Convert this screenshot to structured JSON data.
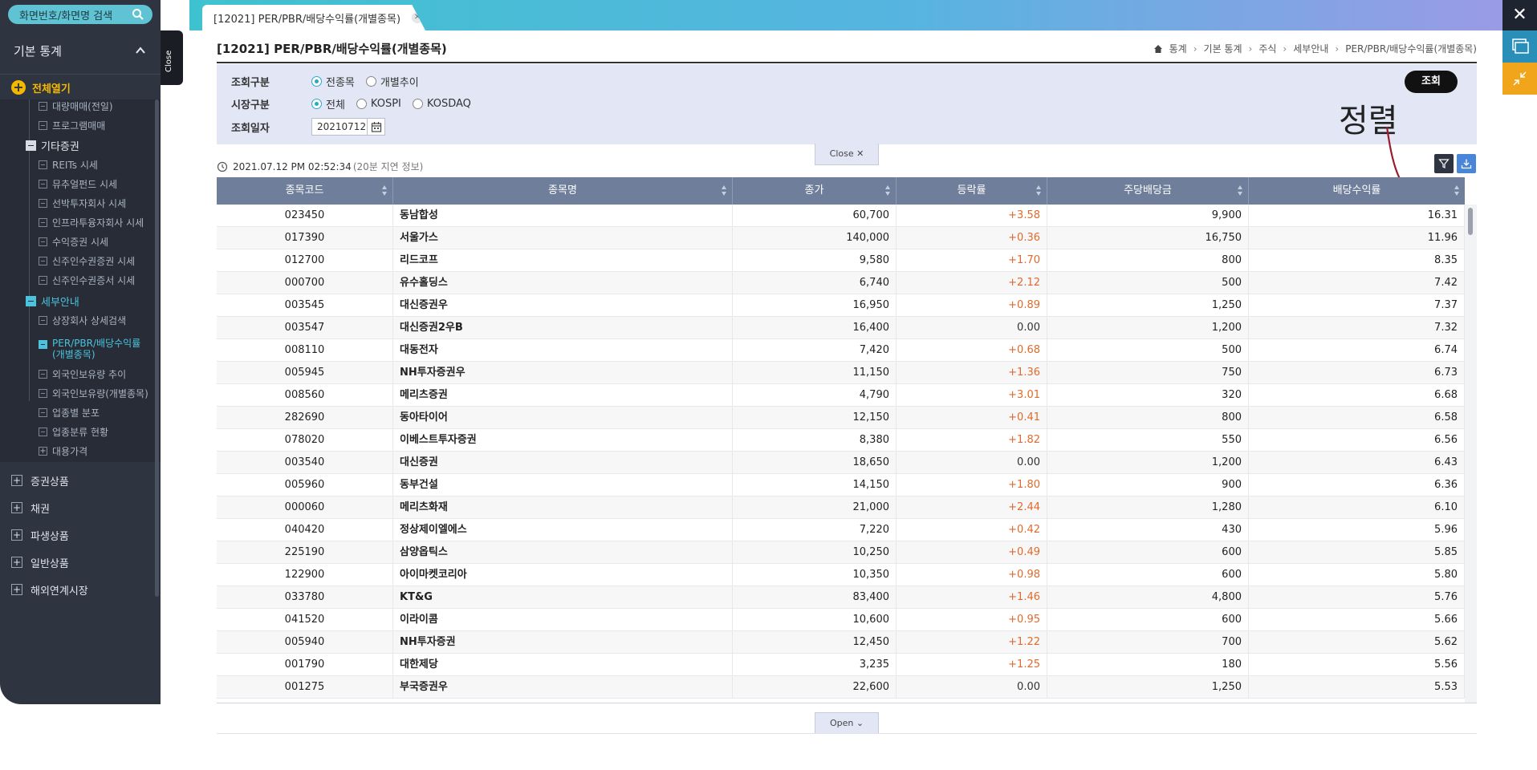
{
  "sidebar": {
    "search_placeholder": "화면번호/화면명 검색",
    "title": "기본 통계",
    "open_all": "전체열기",
    "tree": [
      {
        "label": "대량매매(전일)",
        "kind": "leaf"
      },
      {
        "label": "프로그램매매",
        "kind": "leaf"
      },
      {
        "label": "기타증권",
        "kind": "folder"
      },
      {
        "label": "REITs 시세",
        "kind": "leaf"
      },
      {
        "label": "뮤추얼펀드 시세",
        "kind": "leaf"
      },
      {
        "label": "선박투자회사 시세",
        "kind": "leaf"
      },
      {
        "label": "인프라투융자회사 시세",
        "kind": "leaf"
      },
      {
        "label": "수익증권 시세",
        "kind": "leaf"
      },
      {
        "label": "신주인수권증권 시세",
        "kind": "leaf"
      },
      {
        "label": "신주인수권증서 시세",
        "kind": "leaf"
      },
      {
        "label": "세부안내",
        "kind": "folder-active"
      },
      {
        "label": "상장회사 상세검색",
        "kind": "leaf"
      },
      {
        "label": "PER/PBR/배당수익률(개별종목)",
        "kind": "active"
      },
      {
        "label": "외국인보유량 추이",
        "kind": "leaf"
      },
      {
        "label": "외국인보유량(개별종목)",
        "kind": "leaf"
      },
      {
        "label": "업종별 분포",
        "kind": "leaf"
      },
      {
        "label": "업종분류 현황",
        "kind": "leaf"
      },
      {
        "label": "대용가격",
        "kind": "plus"
      }
    ],
    "sections": [
      "증권상품",
      "채권",
      "파생상품",
      "일반상품",
      "해외연계시장"
    ]
  },
  "close_tab_label": "Close",
  "tab": {
    "label": "[12021] PER/PBR/배당수익률(개별종목)"
  },
  "page_title": "[12021] PER/PBR/배당수익률(개별종목)",
  "breadcrumb": [
    "통계",
    "기본 통계",
    "주식",
    "세부안내",
    "PER/PBR/배당수익률(개별종목)"
  ],
  "filter": {
    "row1_label": "조회구분",
    "row1_options": [
      "전종목",
      "개별추이"
    ],
    "row2_label": "시장구분",
    "row2_options": [
      "전체",
      "KOSPI",
      "KOSDAQ"
    ],
    "row3_label": "조회일자",
    "date_value": "20210712",
    "search_button": "조회"
  },
  "annotation": "정렬",
  "close_pill": "Close",
  "open_pill": "Open",
  "timestamp": "2021.07.12 PM 02:52:34",
  "delay_note": "(20분 지연 정보)",
  "table": {
    "columns": [
      "종목코드",
      "종목명",
      "종가",
      "등락률",
      "주당배당금",
      "배당수익률"
    ],
    "rows": [
      [
        "023450",
        "동남합성",
        "60,700",
        "+3.58",
        "9,900",
        "16.31"
      ],
      [
        "017390",
        "서울가스",
        "140,000",
        "+0.36",
        "16,750",
        "11.96"
      ],
      [
        "012700",
        "리드코프",
        "9,580",
        "+1.70",
        "800",
        "8.35"
      ],
      [
        "000700",
        "유수홀딩스",
        "6,740",
        "+2.12",
        "500",
        "7.42"
      ],
      [
        "003545",
        "대신증권우",
        "16,950",
        "+0.89",
        "1,250",
        "7.37"
      ],
      [
        "003547",
        "대신증권2우B",
        "16,400",
        "0.00",
        "1,200",
        "7.32"
      ],
      [
        "008110",
        "대동전자",
        "7,420",
        "+0.68",
        "500",
        "6.74"
      ],
      [
        "005945",
        "NH투자증권우",
        "11,150",
        "+1.36",
        "750",
        "6.73"
      ],
      [
        "008560",
        "메리츠증권",
        "4,790",
        "+3.01",
        "320",
        "6.68"
      ],
      [
        "282690",
        "동아타이어",
        "12,150",
        "+0.41",
        "800",
        "6.58"
      ],
      [
        "078020",
        "이베스트투자증권",
        "8,380",
        "+1.82",
        "550",
        "6.56"
      ],
      [
        "003540",
        "대신증권",
        "18,650",
        "0.00",
        "1,200",
        "6.43"
      ],
      [
        "005960",
        "동부건설",
        "14,150",
        "+1.80",
        "900",
        "6.36"
      ],
      [
        "000060",
        "메리츠화재",
        "21,000",
        "+2.44",
        "1,280",
        "6.10"
      ],
      [
        "040420",
        "정상제이엘에스",
        "7,220",
        "+0.42",
        "430",
        "5.96"
      ],
      [
        "225190",
        "삼양옵틱스",
        "10,250",
        "+0.49",
        "600",
        "5.85"
      ],
      [
        "122900",
        "아이마켓코리아",
        "10,350",
        "+0.98",
        "600",
        "5.80"
      ],
      [
        "033780",
        "KT&G",
        "83,400",
        "+1.46",
        "4,800",
        "5.76"
      ],
      [
        "041520",
        "이라이콤",
        "10,600",
        "+0.95",
        "600",
        "5.66"
      ],
      [
        "005940",
        "NH투자증권",
        "12,450",
        "+1.22",
        "700",
        "5.62"
      ],
      [
        "001790",
        "대한제당",
        "3,235",
        "+1.25",
        "180",
        "5.56"
      ],
      [
        "001275",
        "부국증권우",
        "22,600",
        "0.00",
        "1,250",
        "5.53"
      ]
    ]
  },
  "colors": {
    "accent": "#2aa8c8",
    "rise": "#e06a2c",
    "header": "#6f7e9a",
    "sidebar": "#2e3440",
    "open_all": "#f5b800"
  }
}
